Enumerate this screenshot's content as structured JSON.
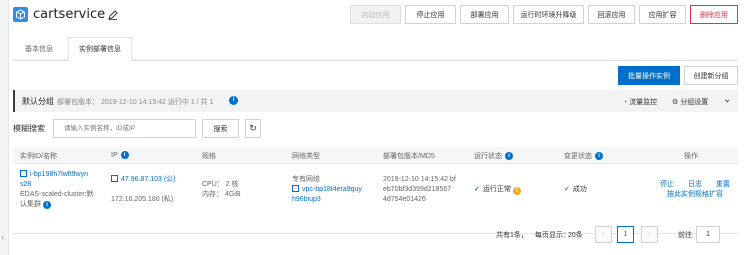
{
  "app": {
    "title": "cartservice"
  },
  "header_buttons": [
    {
      "label": "启动应用",
      "state": "disabled"
    },
    {
      "label": "停止应用",
      "state": "normal"
    },
    {
      "label": "部署应用",
      "state": "normal"
    },
    {
      "label": "运行时环境升降级",
      "state": "normal"
    },
    {
      "label": "回滚应用",
      "state": "normal"
    },
    {
      "label": "应用扩容",
      "state": "normal"
    },
    {
      "label": "删除应用",
      "state": "danger"
    }
  ],
  "tabs": [
    {
      "label": "基本信息",
      "active": false
    },
    {
      "label": "实例部署信息",
      "active": true
    }
  ],
  "actions": {
    "batch_label": "批量操作实例",
    "create_group_label": "创建新分组"
  },
  "group": {
    "name": "默认分组",
    "version_text": "部署包版本： 2019-12-10 14:15:42   运行中 1 / 共 1",
    "monitor_label": "流量监控",
    "settings_label": "分组设置"
  },
  "search": {
    "label": "模糊搜索",
    "placeholder": "请输入实例名称，ID或IP",
    "button_label": "搜索"
  },
  "table": {
    "headers": [
      "实例ID/名称",
      "IP",
      "规格",
      "网络类型",
      "部署包版本/MD5",
      "运行状态",
      "变更状态",
      "操作"
    ],
    "row": {
      "id_line1": "i-bp198h7lwft9wyn",
      "id_line2": "s28",
      "cluster_line1": "EDAS-scaled-cluster:默",
      "cluster_line2": "认集群",
      "ip_public": "47.96.87.103 (公)",
      "ip_private": "172.16.205.180 (私)",
      "spec_cpu": "CPU： 2 核",
      "spec_mem": "内存： 4GiB",
      "network_type": "专有网络",
      "vpc_line1": "vpc-bp18t4era9quy",
      "vpc_line2": "h96biup3",
      "deploy_line1": "2019-12-10 14:15:42 bf",
      "deploy_line2": "eb70bf3d359d218567",
      "deploy_line3": "4d754e01426",
      "run_status": "运行正常",
      "change_status": "成功",
      "op_stop": "停止",
      "op_log": "日志",
      "op_reset": "重置",
      "op_scale": "按此实例规格扩容"
    }
  },
  "pagination": {
    "total_text": "共有1条，",
    "per_page_text": "每页显示：",
    "per_page_value": "20条",
    "current_page": "1",
    "goto_label": "前往",
    "goto_value": "1"
  },
  "colors": {
    "primary": "#0070cc",
    "danger": "#d9363e",
    "success": "#2aa33f",
    "warning": "#f5a623"
  }
}
